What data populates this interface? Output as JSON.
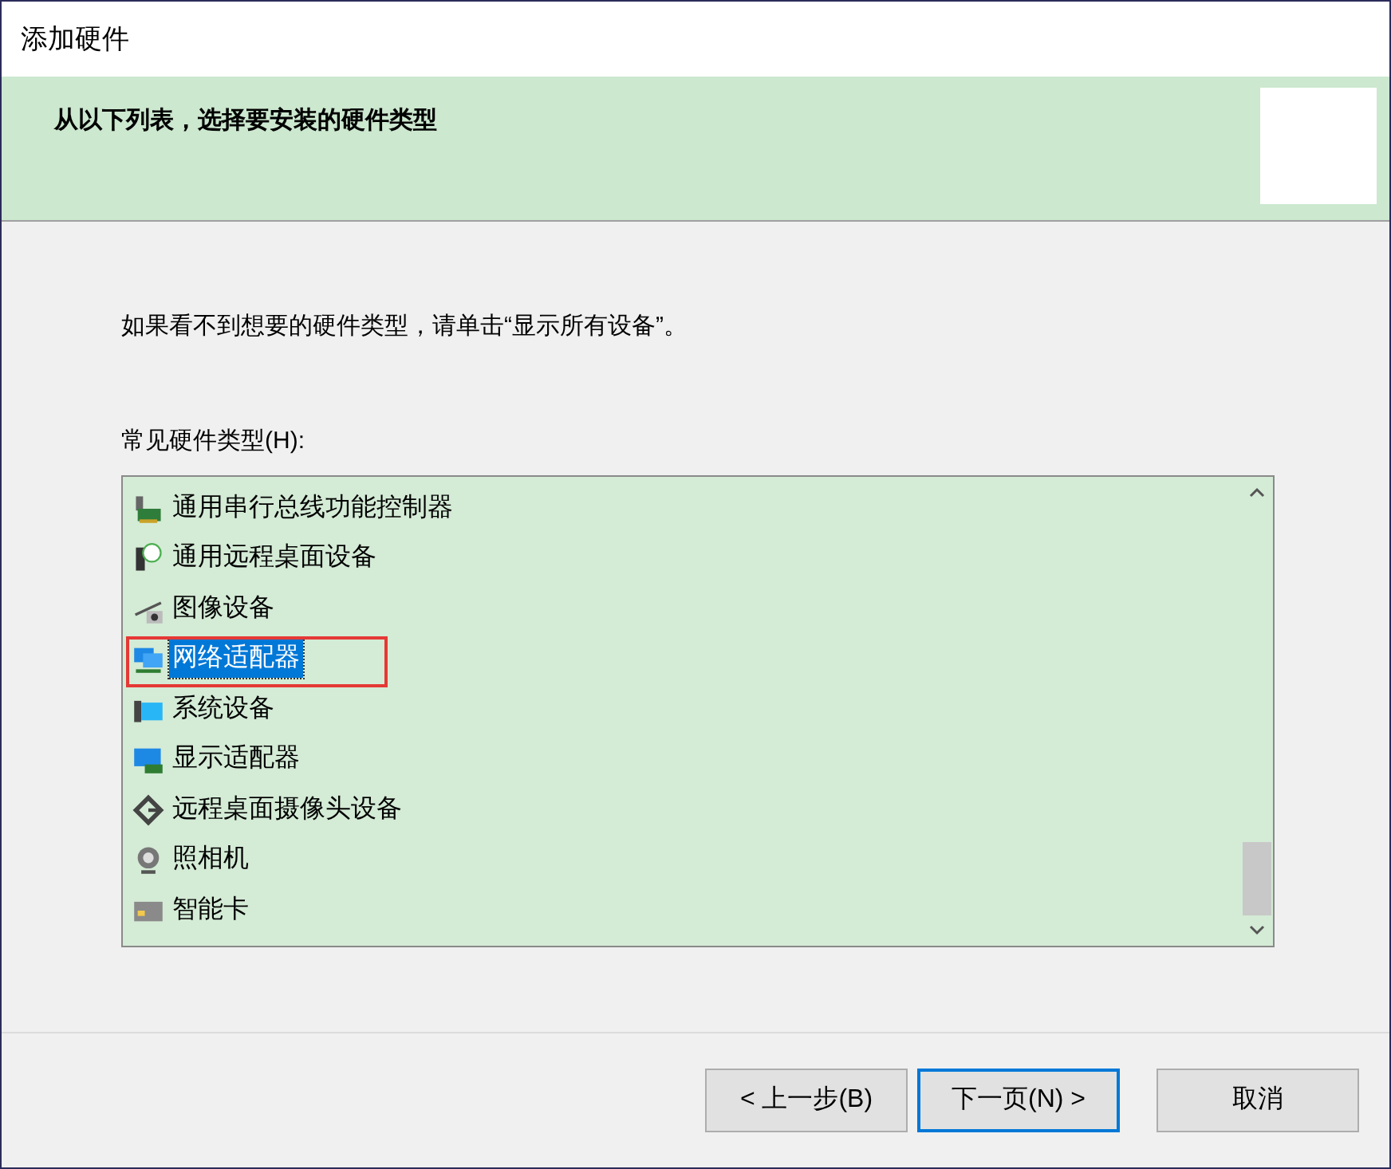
{
  "window": {
    "title": "添加硬件"
  },
  "header": {
    "title": "从以下列表，选择要安装的硬件类型"
  },
  "instruction": "如果看不到想要的硬件类型，请单击“显示所有设备”。",
  "list": {
    "label": "常见硬件类型(H):",
    "items": [
      {
        "label": "通用串行总线功能控制器",
        "selected": false,
        "highlighted": false
      },
      {
        "label": "通用远程桌面设备",
        "selected": false,
        "highlighted": false
      },
      {
        "label": "图像设备",
        "selected": false,
        "highlighted": false
      },
      {
        "label": "网络适配器",
        "selected": true,
        "highlighted": true
      },
      {
        "label": "系统设备",
        "selected": false,
        "highlighted": false
      },
      {
        "label": "显示适配器",
        "selected": false,
        "highlighted": false
      },
      {
        "label": "远程桌面摄像头设备",
        "selected": false,
        "highlighted": false
      },
      {
        "label": "照相机",
        "selected": false,
        "highlighted": false
      },
      {
        "label": "智能卡",
        "selected": false,
        "highlighted": false
      }
    ]
  },
  "buttons": [
    {
      "label": "< 上一步(B)",
      "default": false
    },
    {
      "label": "下一页(N) >",
      "default": true
    },
    {
      "label": "取消",
      "default": false
    }
  ]
}
